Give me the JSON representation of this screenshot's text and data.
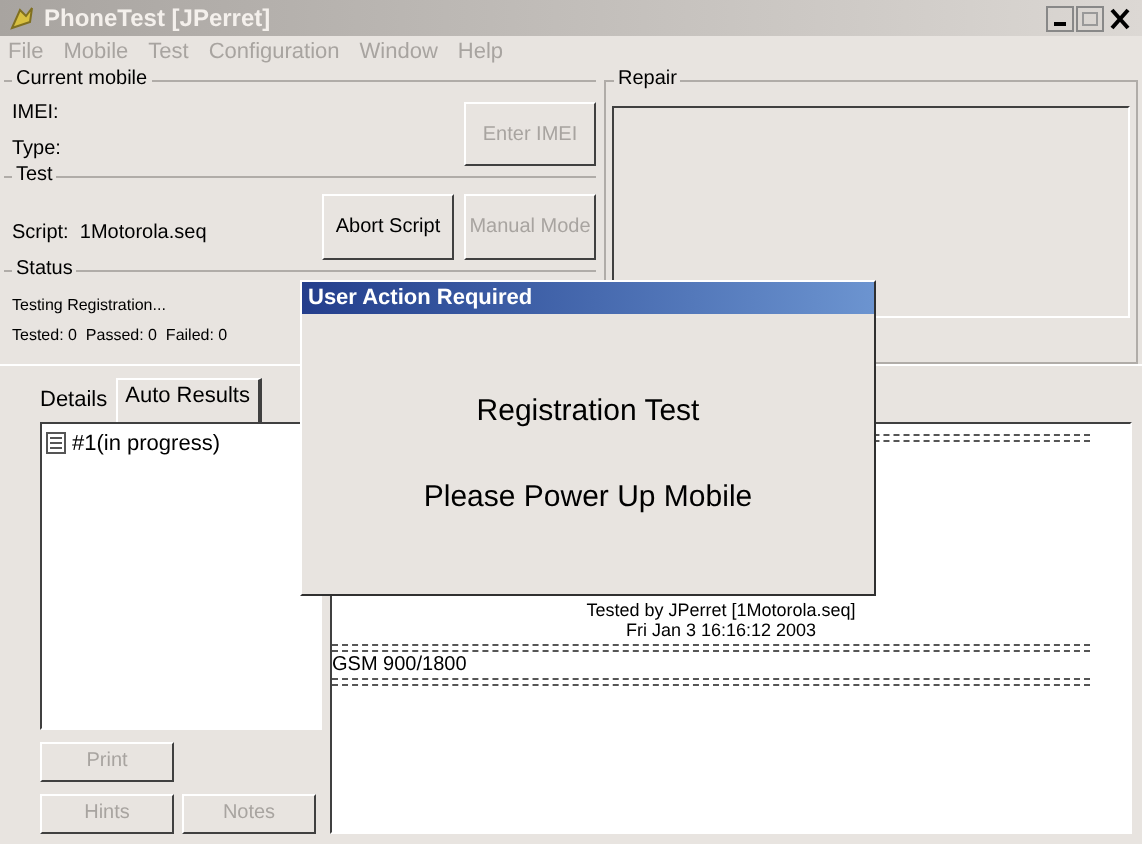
{
  "window": {
    "title": "PhoneTest [JPerret]"
  },
  "menu": [
    "File",
    "Mobile",
    "Test",
    "Configuration",
    "Window",
    "Help"
  ],
  "current_mobile": {
    "title": "Current mobile",
    "fields": [
      "IMEI:",
      "Type:"
    ],
    "button": {
      "label": "Enter IMEI",
      "disabled": true
    }
  },
  "test": {
    "title": "Test",
    "script": "Script:  1Motorola.seq",
    "buttons": [
      {
        "label": "Abort Script",
        "disabled": false
      },
      {
        "label": "Manual Mode",
        "disabled": true
      }
    ]
  },
  "status": {
    "title": "Status",
    "lines": [
      "Testing Registration...",
      "Tested: 0  Passed: 0  Failed: 0"
    ]
  },
  "repair": {
    "title": "Repair"
  },
  "tabs": [
    {
      "label": "Details",
      "selected": false
    },
    {
      "label": "Auto Results",
      "selected": true
    }
  ],
  "results_list": [
    "#1(in progress)"
  ],
  "left_buttons": [
    {
      "label": "Print",
      "disabled": true
    },
    {
      "label": "Hints",
      "disabled": true
    },
    {
      "label": "Notes",
      "disabled": true
    }
  ],
  "report": {
    "header": [
      "Tested by JPerret [1Motorola.seq]",
      "Fri Jan 3 16:16:12 2003"
    ],
    "band": "GSM 900/1800"
  },
  "dialog": {
    "title": "User Action Required",
    "lines": [
      "Registration Test",
      "Please Power Up Mobile"
    ]
  }
}
